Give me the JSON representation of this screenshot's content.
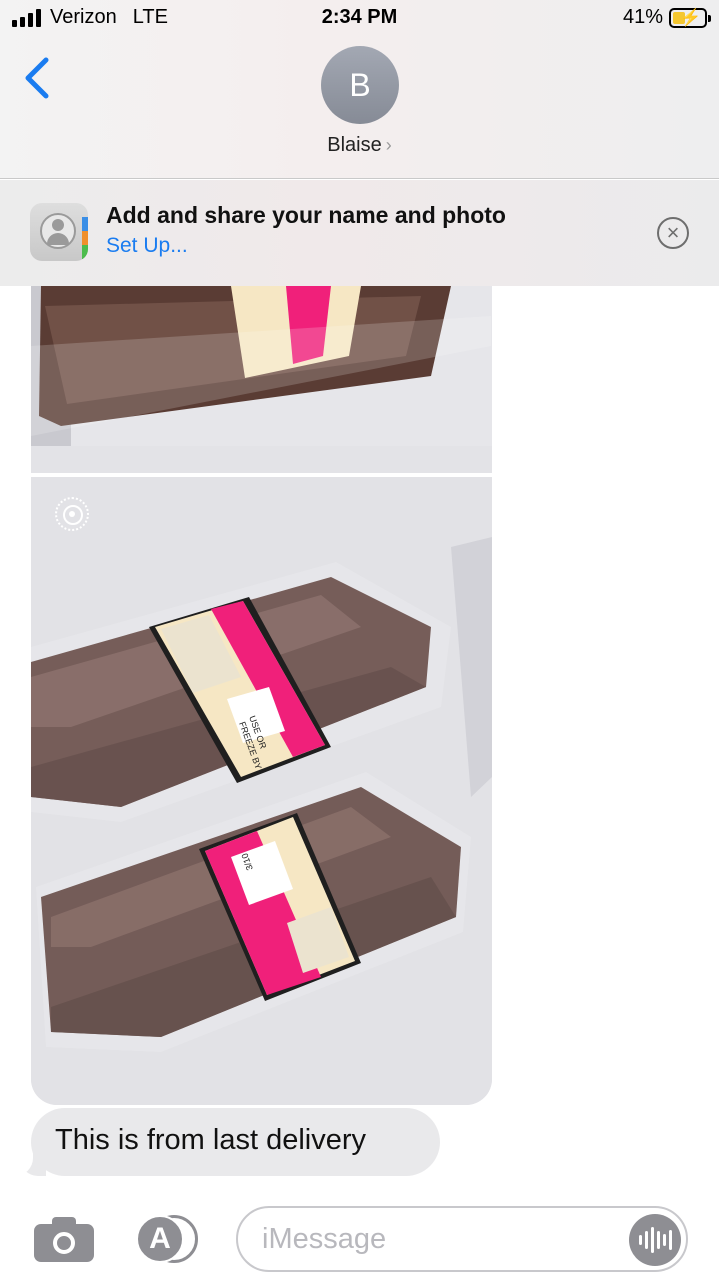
{
  "status_bar": {
    "carrier": "Verizon",
    "network": "LTE",
    "time": "2:34 PM",
    "battery_percent": "41%",
    "battery_level": 0.41,
    "battery_charging": true
  },
  "header": {
    "avatar_initial": "B",
    "contact_name": "Blaise",
    "icons": {
      "back": "chevron-left-icon",
      "contact_detail": "chevron-right-icon"
    }
  },
  "share_banner": {
    "title": "Add and share your name and photo",
    "action_label": "Set Up...",
    "icons": {
      "app": "contacts-app-icon",
      "dismiss": "close-circle-icon"
    }
  },
  "conversation": {
    "attachments": [
      {
        "type": "photo",
        "live": false
      },
      {
        "type": "photo",
        "live": true
      }
    ],
    "messages": [
      {
        "from": "contact",
        "text": "This is from last delivery"
      }
    ],
    "photo_labels": {
      "use_by_line1": "USE OR",
      "use_by_line2": "FREEZE BY",
      "date": "3/10"
    }
  },
  "input_bar": {
    "placeholder": "iMessage",
    "icons": {
      "camera": "camera-icon",
      "apps": "app-store-icon",
      "audio": "audio-waveform-icon"
    }
  },
  "colors": {
    "accent": "#1a7cf0",
    "bubble_incoming": "#e9e9eb",
    "icon_gray": "#8e8e93",
    "label_pink": "#f0207a",
    "label_cream": "#f6e7c4",
    "battery_fill": "#f4c730"
  }
}
